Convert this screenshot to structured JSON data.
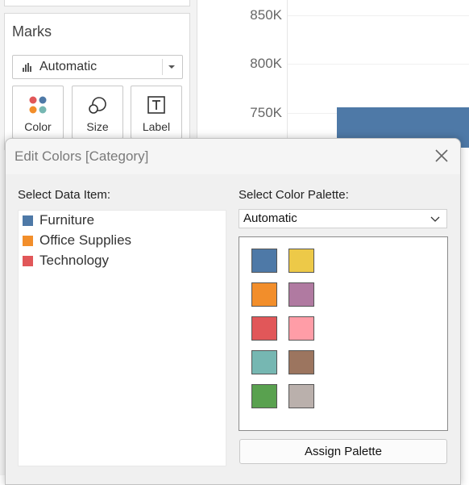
{
  "chart": {
    "y_ticks": [
      "850K",
      "800K",
      "750K"
    ],
    "bar_color": "#4e79a7"
  },
  "marks": {
    "title": "Marks",
    "mark_type": "Automatic",
    "buttons": [
      {
        "label": "Color",
        "icon": "color-dots-icon"
      },
      {
        "label": "Size",
        "icon": "size-circles-icon"
      },
      {
        "label": "Label",
        "icon": "text-label-icon"
      }
    ]
  },
  "dialog": {
    "title": "Edit Colors [Category]",
    "data_item_label": "Select Data Item:",
    "palette_label": "Select Color Palette:",
    "palette_value": "Automatic",
    "items": [
      {
        "name": "Furniture",
        "color": "#4e79a7"
      },
      {
        "name": "Office Supplies",
        "color": "#f28e2b"
      },
      {
        "name": "Technology",
        "color": "#e15759"
      }
    ],
    "palette_colors": [
      "#4e79a7",
      "#edc948",
      "#f28e2b",
      "#b07aa1",
      "#e15759",
      "#ff9da7",
      "#76b7b2",
      "#9c755f",
      "#59a14f",
      "#bab0ac"
    ],
    "assign_label": "Assign Palette"
  }
}
